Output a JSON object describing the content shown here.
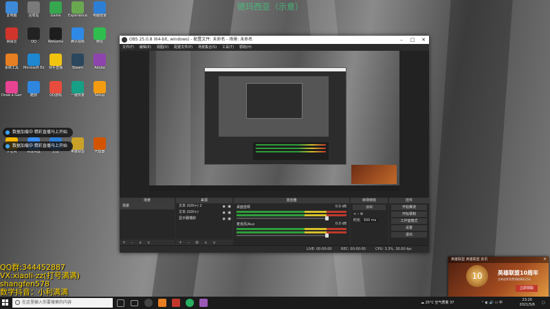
{
  "overlay": {
    "top_banner": "德玛西亚（示意）",
    "watermark_lines": [
      "QQ群:344452887",
      "VX:xiaoli-zz(打号满满)",
      "shangfen578",
      "数学抖音：小利满满"
    ]
  },
  "desktop_icons": [
    {
      "label": "此电脑",
      "color": "#3c8ad8"
    },
    {
      "label": "回收站",
      "color": "#7a7a7a"
    },
    {
      "label": "Game",
      "color": "#36a64f"
    },
    {
      "label": "Experience",
      "color": "#6aa84f"
    },
    {
      "label": "电脑管家",
      "color": "#2d7fd6"
    },
    {
      "label": "网易云",
      "color": "#d0342c"
    },
    {
      "label": "QQ",
      "color": "#222"
    },
    {
      "label": "WeGame",
      "color": "#1d1d1d"
    },
    {
      "label": "腾讯视频",
      "color": "#2e8ae6"
    },
    {
      "label": "微信",
      "color": "#2ebd4e"
    },
    {
      "label": "系统工具",
      "color": "#e67e22"
    },
    {
      "label": "Microsoft Edge",
      "color": "#1d88d1"
    },
    {
      "label": "快手直播",
      "color": "#f1c40f"
    },
    {
      "label": "Steam",
      "color": "#2a475e"
    },
    {
      "label": "Adobe",
      "color": "#8e44ad"
    },
    {
      "label": "Draw a Game",
      "color": "#e84393"
    },
    {
      "label": "酷狗",
      "color": "#2e86de"
    },
    {
      "label": "QQ游戏",
      "color": "#e74c3c"
    },
    {
      "label": "一键恢复",
      "color": "#16a085"
    },
    {
      "label": "Setup",
      "color": "#f39c12"
    },
    {
      "label": "作业网",
      "color": "#f5b400"
    },
    {
      "label": "百度网盘",
      "color": "#3a8ef6"
    },
    {
      "label": "迅雷",
      "color": "#2d7fd6"
    },
    {
      "label": "英雄联盟",
      "color": "#c9a227"
    },
    {
      "label": "代理器",
      "color": "#d35400"
    }
  ],
  "notices": [
    "数据加载中 精彩直播马上开始",
    "数据加载中 精彩直播马上开始"
  ],
  "obs": {
    "title": "OBS 25.0.8 (64-bit, windows) - 配置文件: 未命名 - 场景: 未命名",
    "menu": [
      "文件(F)",
      "编辑(E)",
      "视图(V)",
      "配置文件(P)",
      "场景集合(S)",
      "工具(T)",
      "帮助(H)"
    ],
    "panels": {
      "scenes": "场景",
      "sources": "来源",
      "mixer": "混音器",
      "transitions": "转场特效",
      "controls": "控件"
    },
    "scene_items": [
      "场景"
    ],
    "source_items": [
      "文本 (GDI+) 2",
      "文本 (GDI+)",
      "显示器捕获"
    ],
    "mixer_items": [
      {
        "name": "桌面音频",
        "db": "0.0 dB"
      },
      {
        "name": "麦克风/Aux",
        "db": "0.0 dB"
      }
    ],
    "transition": {
      "type": "淡出",
      "duration_label": "时长",
      "duration": "300 ms"
    },
    "control_buttons": [
      "开始推流",
      "开始录制",
      "工作室模式",
      "设置",
      "退出"
    ],
    "status": {
      "live": "LIVE: 00:00:00",
      "rec": "REC: 00:00:00",
      "cpu": "CPU: 3.3%, 30.00 fps"
    }
  },
  "ad": {
    "header": "英雄联盟  英雄联盟  资讯",
    "badge": "10",
    "title": "英雄联盟10周年",
    "sub": "全新皮肤免费领取精彩活动",
    "cta": "立即领取"
  },
  "taskbar": {
    "search_placeholder": "在这里输入你要搜索的内容",
    "weather": "25°C 空气质量 37",
    "time": "23:20",
    "date": "2021/5/6"
  }
}
